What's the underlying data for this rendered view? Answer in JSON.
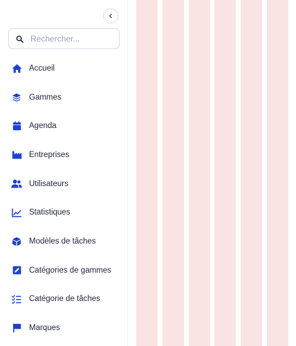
{
  "sidebar": {
    "search": {
      "placeholder": "Rechercher...",
      "value": ""
    },
    "items": [
      {
        "label": "Accueil",
        "icon": "home-icon"
      },
      {
        "label": "Gammes",
        "icon": "layers-icon"
      },
      {
        "label": "Agenda",
        "icon": "calendar-icon"
      },
      {
        "label": "Entreprises",
        "icon": "factory-icon"
      },
      {
        "label": "Utilisateurs",
        "icon": "users-icon"
      },
      {
        "label": "Statistiques",
        "icon": "chart-line-icon"
      },
      {
        "label": "Modèles de tâches",
        "icon": "box-icon"
      },
      {
        "label": "Catégories de gammes",
        "icon": "edit-square-icon"
      },
      {
        "label": "Catégorie de tâches",
        "icon": "checklist-icon"
      },
      {
        "label": "Marques",
        "icon": "flag-icon"
      }
    ]
  },
  "colors": {
    "accent": "#1d3fd6",
    "text": "#1b2437",
    "placeholder": "#9aa3b2",
    "stripe": "#f9e3e3"
  }
}
